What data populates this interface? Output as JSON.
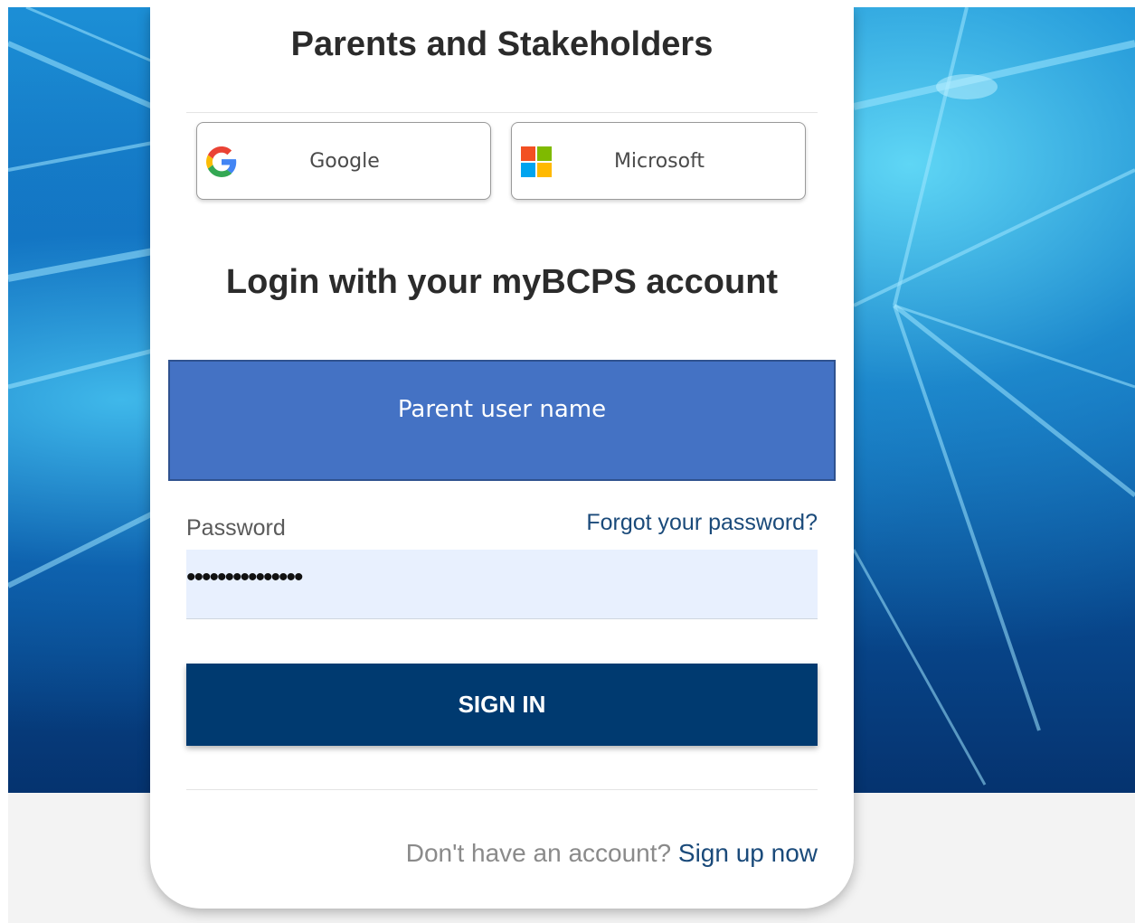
{
  "card": {
    "title": "Parents and Stakeholders",
    "heading": "Login with your myBCPS account"
  },
  "social": [
    {
      "label": "Google",
      "icon": "google-logo-icon"
    },
    {
      "label": "Microsoft",
      "icon": "microsoft-logo-icon"
    }
  ],
  "form": {
    "username_placeholder": "Parent user name",
    "password_label": "Password",
    "forgot_link": "Forgot your password?",
    "password_value": "•••••••••••••••",
    "sign_in_label": "SIGN IN"
  },
  "footer": {
    "prompt": "Don't have an account?",
    "signup_link": "Sign up now"
  },
  "colors": {
    "sign_in": "#003a70",
    "link": "#1a4a7a",
    "username_box": "#4472c4",
    "password_field": "#e8f0fe"
  }
}
